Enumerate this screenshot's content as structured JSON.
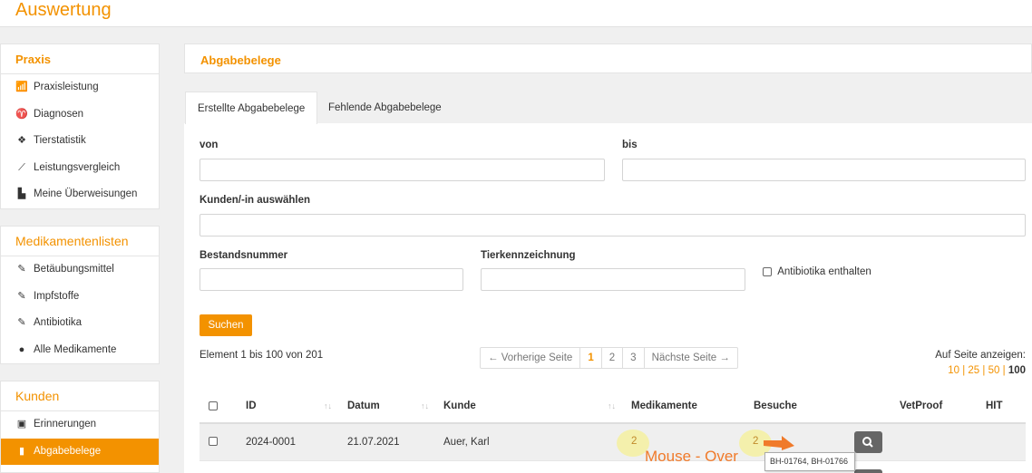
{
  "page": {
    "title": "Auswertung"
  },
  "sidebar": {
    "praxis": {
      "title": "Praxis",
      "items": [
        {
          "label": "Praxisleistung",
          "icon": "bar-chart-icon"
        },
        {
          "label": "Diagnosen",
          "icon": "stethoscope-icon"
        },
        {
          "label": "Tierstatistik",
          "icon": "paw-icon"
        },
        {
          "label": "Leistungsvergleich",
          "icon": "line-chart-icon"
        },
        {
          "label": "Meine Überweisungen",
          "icon": "file-export-icon"
        }
      ]
    },
    "medikamente": {
      "title": "Medikamentenlisten",
      "items": [
        {
          "label": "Betäubungsmittel",
          "icon": "syringe-icon"
        },
        {
          "label": "Impfstoffe",
          "icon": "syringe-icon"
        },
        {
          "label": "Antibiotika",
          "icon": "syringe-icon"
        },
        {
          "label": "Alle Medikamente",
          "icon": "pills-icon"
        }
      ]
    },
    "kunden": {
      "title": "Kunden",
      "items": [
        {
          "label": "Erinnerungen",
          "icon": "gift-icon"
        },
        {
          "label": "Abgabebelege",
          "icon": "receipt-icon",
          "active": true
        }
      ]
    }
  },
  "main": {
    "title": "Abgabebelege",
    "tabs": [
      {
        "label": "Erstellte Abgabebelege",
        "active": true
      },
      {
        "label": "Fehlende Abgabebelege",
        "active": false
      }
    ]
  },
  "form": {
    "von_label": "von",
    "von_value": "",
    "bis_label": "bis",
    "bis_value": "",
    "kunde_label": "Kunden/-in auswählen",
    "kunde_value": "",
    "bestand_label": "Bestandsnummer",
    "bestand_value": "",
    "tier_label": "Tierkennzeichnung",
    "tier_value": "",
    "antibiotika_label": "Antibiotika enthalten",
    "search_button": "Suchen"
  },
  "results": {
    "summary": "Element 1 bis 100 von 201",
    "pager": {
      "prev": "← Vorherige Seite",
      "pages": [
        "1",
        "2",
        "3"
      ],
      "current": "1",
      "next": "Nächste Seite →"
    },
    "page_size_label": "Auf Seite anzeigen:",
    "page_size_options": [
      "10",
      "25",
      "50",
      "100"
    ],
    "page_size_selected": "100",
    "separator": "|"
  },
  "table": {
    "headers": {
      "id": "ID",
      "datum": "Datum",
      "kunde": "Kunde",
      "medikamente": "Medikamente",
      "besuche": "Besuche",
      "vetproof": "VetProof",
      "hit": "HIT"
    },
    "sort_glyph": "↑↓",
    "rows": [
      {
        "id": "2024-0001",
        "datum": "21.07.2021",
        "kunde": "Auer, Karl",
        "medikamente": "2",
        "besuche": "2"
      }
    ]
  },
  "tooltip": {
    "text": "BH-01764, BH-01766"
  },
  "annotation": {
    "text": "Mouse - Over",
    "color": "#f07a2a"
  },
  "colors": {
    "accent": "#f39200",
    "highlight": "#f5f0a0"
  }
}
